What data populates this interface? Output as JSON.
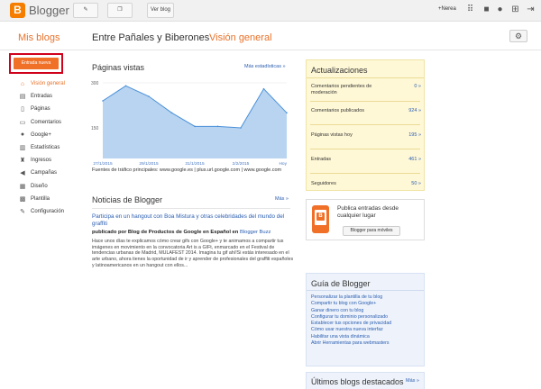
{
  "topbar": {
    "logo_letter": "B",
    "brand": "Blogger",
    "pencil_icon": "pencil-icon",
    "copy_icon": "copy-icon",
    "view_blog": "Ver blog",
    "user": "+Nerea",
    "icons": [
      "apps-grid-icon",
      "bell-icon",
      "avatar-icon",
      "share-icon",
      "signout-icon"
    ]
  },
  "header": {
    "my_blogs": "Mis blogs",
    "blog_name": "Entre Pañales y Biberones",
    "separator": "·",
    "section": "Visión general",
    "settings_icon": "gear-icon"
  },
  "nav": {
    "new_post": "Entrada nueva",
    "items": [
      {
        "label": "Visión general",
        "icon": "home-icon",
        "glyph": "⌂",
        "active": true
      },
      {
        "label": "Entradas",
        "icon": "posts-icon",
        "glyph": "▤",
        "active": false
      },
      {
        "label": "Páginas",
        "icon": "pages-icon",
        "glyph": "▯",
        "active": false
      },
      {
        "label": "Comentarios",
        "icon": "comment-icon",
        "glyph": "▭",
        "active": false
      },
      {
        "label": "Google+",
        "icon": "googleplus-icon",
        "glyph": "●",
        "active": false
      },
      {
        "label": "Estadísticas",
        "icon": "stats-icon",
        "glyph": "▥",
        "active": false
      },
      {
        "label": "Ingresos",
        "icon": "trophy-icon",
        "glyph": "♜",
        "active": false
      },
      {
        "label": "Campañas",
        "icon": "megaphone-icon",
        "glyph": "◀",
        "active": false
      },
      {
        "label": "Diseño",
        "icon": "layout-icon",
        "glyph": "▦",
        "active": false
      },
      {
        "label": "Plantilla",
        "icon": "template-icon",
        "glyph": "▩",
        "active": false
      },
      {
        "label": "Configuración",
        "icon": "wrench-icon",
        "glyph": "✎",
        "active": false
      }
    ]
  },
  "pageviews": {
    "title": "Páginas vistas",
    "more_stats": "Más estadísticas »",
    "traffic": "Fuentes de tráfico principales: www.google.es | plus.url.google.com | www.google.com"
  },
  "chart_data": {
    "type": "area",
    "x": [
      "27/1/2015",
      "28/1/2015",
      "29/1/2015",
      "30/1/2015",
      "31/1/2015",
      "1/2/2015",
      "2/2/2015",
      "3/2/2015",
      "Hoy"
    ],
    "x_tick_labels": [
      "27/1/2015",
      "29/1/2015",
      "31/1/2015",
      "2/2/2015",
      "Hoy"
    ],
    "values": [
      240,
      290,
      255,
      200,
      155,
      155,
      150,
      280,
      200
    ],
    "y_ticks": [
      "300",
      "150"
    ],
    "ylim": [
      0,
      300
    ],
    "color": "#4a90d9",
    "fill": "#b8d4f0",
    "grid": true
  },
  "news": {
    "title": "Noticias de Blogger",
    "more": "Más »",
    "post_title": "Participa en un hangout con Boa Mistura y otras celebridades del mundo del graffiti",
    "by_prefix": "publicado por Blog de Productos de Google en Español en ",
    "by_link": "Blogger Buzz",
    "body": "Hace unos días te explicamos cómo crear gifs con Google+ y te animamos a compartir tus imágenes en movimiento en la convocatoria Art is a GIFt, enmarcado en el Festival de tendencias urbanas de Madrid, MULAFEST 2014. Imagina tu gif ahí!Si estás interesado en el arte urbano, ahora tienes la oportunidad de ir y aprender de profesionales del graffiti españoles y latinoamericanos en un hangout con ellos..."
  },
  "updates": {
    "title": "Actualizaciones",
    "rows": [
      {
        "label": "Comentarios pendientes de moderación",
        "value": "0 »"
      },
      {
        "label": "Comentarios publicados",
        "value": "924 »"
      },
      {
        "label": "Páginas vistas hoy",
        "value": "195 »"
      },
      {
        "label": "Entradas",
        "value": "461 »"
      },
      {
        "label": "Seguidores",
        "value": "50 »"
      }
    ]
  },
  "mobile": {
    "text": "Publica entradas desde cualquier lugar",
    "button": "Blogger para móviles",
    "icon": "phone-icon"
  },
  "guide": {
    "title": "Guía de Blogger",
    "links": [
      "Personalizar la plantilla de tu blog",
      "Compartir tu blog con Google+",
      "Ganar dinero con tu blog",
      "Configurar tu dominio personalizado",
      "Establecer tus opciones de privacidad",
      "Cómo usar nuestra nueva interfaz",
      "Habilitar una vista dinámica",
      "Abrir Herramientas para webmasters"
    ]
  },
  "featured": {
    "title": "Últimos blogs destacados",
    "more": "Más »"
  }
}
